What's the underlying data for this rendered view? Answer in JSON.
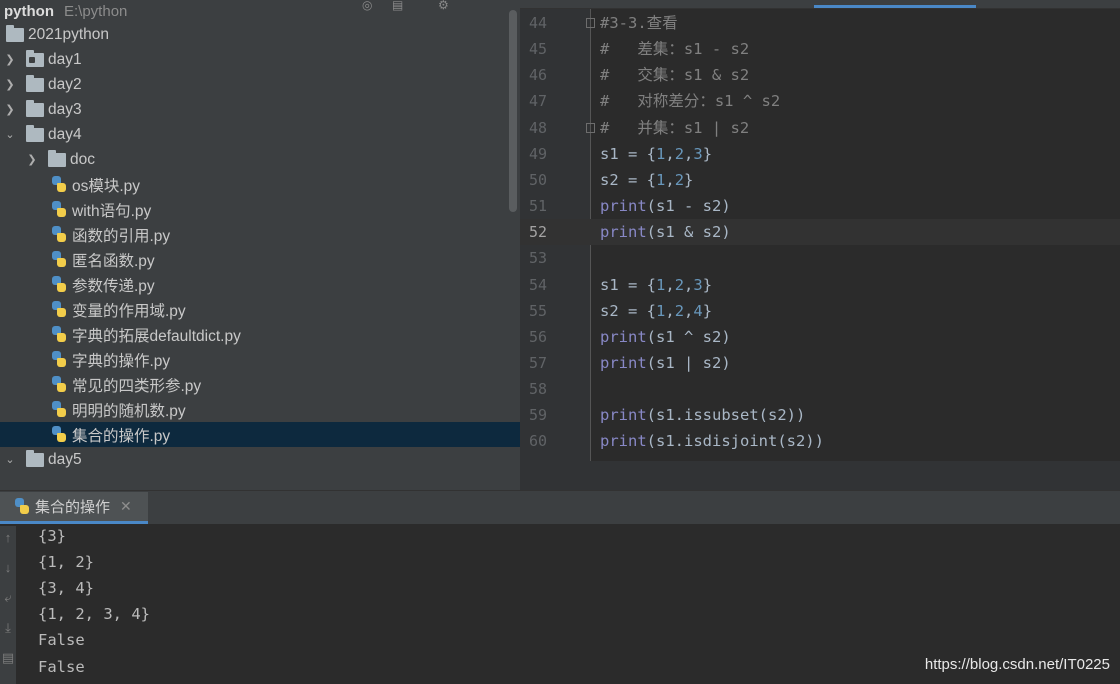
{
  "project": {
    "name": "python",
    "path": "E:\\python",
    "root": "2021python",
    "folders": [
      "day1",
      "day2",
      "day3",
      "day4",
      "doc",
      "day5"
    ],
    "files": [
      "os模块.py",
      "with语句.py",
      "函数的引用.py",
      "匿名函数.py",
      "参数传递.py",
      "变量的作用域.py",
      "字典的拓展defaultdict.py",
      "字典的操作.py",
      "常见的四类形参.py",
      "明明的随机数.py",
      "集合的操作.py"
    ]
  },
  "editor": {
    "lines": [
      {
        "n": "44",
        "t": "#3-3.查看"
      },
      {
        "n": "45",
        "t": "#   差集：s1 - s2"
      },
      {
        "n": "46",
        "t": "#   交集：s1 & s2"
      },
      {
        "n": "47",
        "t": "#   对称差分：s1 ^ s2"
      },
      {
        "n": "48",
        "t": "#   并集：s1 | s2"
      },
      {
        "n": "49",
        "t": "s1 = {1,2,3}"
      },
      {
        "n": "50",
        "t": "s2 = {1,2}"
      },
      {
        "n": "51",
        "t": "print(s1 - s2)"
      },
      {
        "n": "52",
        "t": "print(s1 & s2)"
      },
      {
        "n": "53",
        "t": ""
      },
      {
        "n": "54",
        "t": "s1 = {1,2,3}"
      },
      {
        "n": "55",
        "t": "s2 = {1,2,4}"
      },
      {
        "n": "56",
        "t": "print(s1 ^ s2)"
      },
      {
        "n": "57",
        "t": "print(s1 | s2)"
      },
      {
        "n": "58",
        "t": ""
      },
      {
        "n": "59",
        "t": "print(s1.issubset(s2))"
      },
      {
        "n": "60",
        "t": "print(s1.isdisjoint(s2))"
      }
    ]
  },
  "run": {
    "tab_label": "集合的操作",
    "output": [
      "{3}",
      "{1, 2}",
      "{3, 4}",
      "{1, 2, 3, 4}",
      "False",
      "False"
    ]
  },
  "watermark": "https://blog.csdn.net/IT0225",
  "colors": {
    "comment": "#808080",
    "number": "#6897bb",
    "builtin": "#8888c6",
    "selection": "#0d293e",
    "tab_accent": "#4a88c7"
  }
}
